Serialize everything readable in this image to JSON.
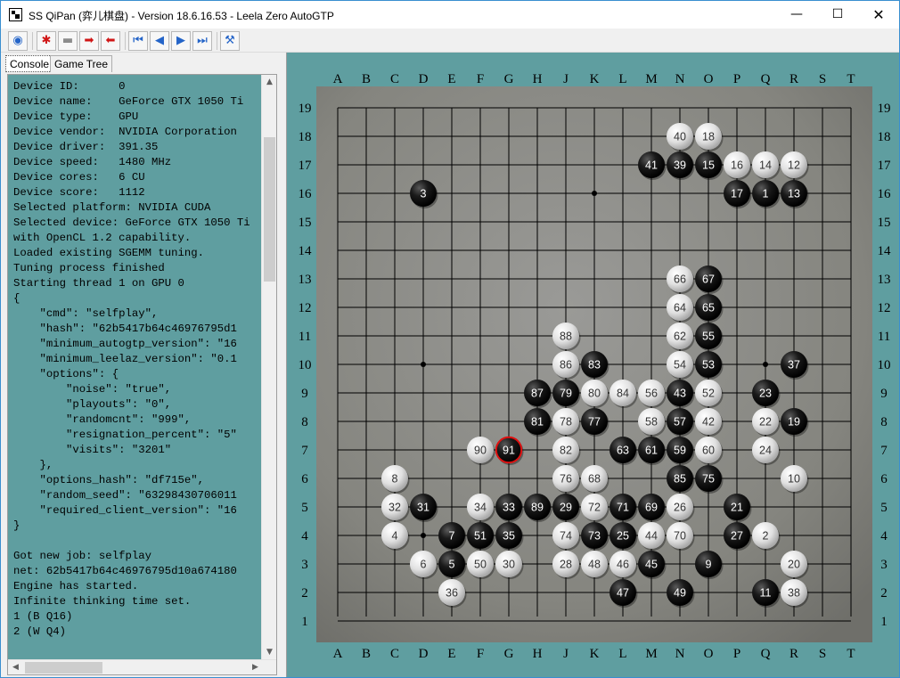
{
  "window": {
    "title": "SS QiPan (弈儿棋盘) - Version 18.6.16.53 - Leela Zero AutoGTP",
    "minimize_glyph": "—",
    "maximize_glyph": "☐",
    "close_glyph": "✕"
  },
  "toolbar": {
    "buttons": [
      {
        "name": "view-icon",
        "glyph": "◉",
        "style": "blue"
      },
      {
        "name": "mark-icon",
        "glyph": "✱",
        "style": "red"
      },
      {
        "name": "remove-icon",
        "glyph": "▬",
        "style": "gray"
      },
      {
        "name": "move-forward-icon",
        "glyph": "➡",
        "style": "red"
      },
      {
        "name": "move-back-icon",
        "glyph": "⬅",
        "style": "red"
      },
      {
        "name": "first-move-icon",
        "glyph": "⏮",
        "style": "blue"
      },
      {
        "name": "previous-move-icon",
        "glyph": "◀",
        "style": "blue"
      },
      {
        "name": "next-move-icon",
        "glyph": "▶",
        "style": "blue"
      },
      {
        "name": "last-move-icon",
        "glyph": "⏭",
        "style": "blue"
      },
      {
        "name": "settings-icon",
        "glyph": "⚒",
        "style": "blue"
      }
    ]
  },
  "tabs": {
    "console": "Console",
    "game_tree": "Game Tree"
  },
  "console": {
    "lines": [
      "Device ID:      0",
      "Device name:    GeForce GTX 1050 Ti",
      "Device type:    GPU",
      "Device vendor:  NVIDIA Corporation",
      "Device driver:  391.35",
      "Device speed:   1480 MHz",
      "Device cores:   6 CU",
      "Device score:   1112",
      "Selected platform: NVIDIA CUDA",
      "Selected device: GeForce GTX 1050 Ti",
      "with OpenCL 1.2 capability.",
      "Loaded existing SGEMM tuning.",
      "Tuning process finished",
      "Starting thread 1 on GPU 0",
      "{",
      "    \"cmd\": \"selfplay\",",
      "    \"hash\": \"62b5417b64c46976795d1",
      "    \"minimum_autogtp_version\": \"16",
      "    \"minimum_leelaz_version\": \"0.1",
      "    \"options\": {",
      "        \"noise\": \"true\",",
      "        \"playouts\": \"0\",",
      "        \"randomcnt\": \"999\",",
      "        \"resignation_percent\": \"5\"",
      "        \"visits\": \"3201\"",
      "    },",
      "    \"options_hash\": \"df715e\",",
      "    \"random_seed\": \"63298430706011",
      "    \"required_client_version\": \"16",
      "}",
      "",
      "Got new job: selfplay",
      "net: 62b5417b64c46976795d10a674180",
      "Engine has started.",
      "Infinite thinking time set.",
      "1 (B Q16)",
      "2 (W Q4)"
    ]
  },
  "board": {
    "size": 19,
    "columns": [
      "A",
      "B",
      "C",
      "D",
      "E",
      "F",
      "G",
      "H",
      "J",
      "K",
      "L",
      "M",
      "N",
      "O",
      "P",
      "Q",
      "R",
      "S",
      "T"
    ],
    "last_move": 91,
    "stones": [
      {
        "n": 1,
        "c": "B",
        "at": "Q16"
      },
      {
        "n": 2,
        "c": "W",
        "at": "Q4"
      },
      {
        "n": 3,
        "c": "B",
        "at": "D16"
      },
      {
        "n": 4,
        "c": "W",
        "at": "C4"
      },
      {
        "n": 5,
        "c": "B",
        "at": "E3"
      },
      {
        "n": 6,
        "c": "W",
        "at": "D3"
      },
      {
        "n": 7,
        "c": "B",
        "at": "E4"
      },
      {
        "n": 8,
        "c": "W",
        "at": "C6"
      },
      {
        "n": 9,
        "c": "B",
        "at": "O3"
      },
      {
        "n": 10,
        "c": "W",
        "at": "R6"
      },
      {
        "n": 11,
        "c": "B",
        "at": "Q2"
      },
      {
        "n": 12,
        "c": "W",
        "at": "R17"
      },
      {
        "n": 13,
        "c": "B",
        "at": "R16"
      },
      {
        "n": 14,
        "c": "W",
        "at": "Q17"
      },
      {
        "n": 15,
        "c": "B",
        "at": "O17"
      },
      {
        "n": 16,
        "c": "W",
        "at": "P17"
      },
      {
        "n": 17,
        "c": "B",
        "at": "P16"
      },
      {
        "n": 18,
        "c": "W",
        "at": "O18"
      },
      {
        "n": 19,
        "c": "B",
        "at": "R8"
      },
      {
        "n": 20,
        "c": "W",
        "at": "R3"
      },
      {
        "n": 21,
        "c": "B",
        "at": "P5"
      },
      {
        "n": 22,
        "c": "W",
        "at": "Q8"
      },
      {
        "n": 23,
        "c": "B",
        "at": "Q9"
      },
      {
        "n": 24,
        "c": "W",
        "at": "Q7"
      },
      {
        "n": 25,
        "c": "B",
        "at": "L4"
      },
      {
        "n": 26,
        "c": "W",
        "at": "N5"
      },
      {
        "n": 27,
        "c": "B",
        "at": "P4"
      },
      {
        "n": 28,
        "c": "W",
        "at": "J3"
      },
      {
        "n": 29,
        "c": "B",
        "at": "J5"
      },
      {
        "n": 30,
        "c": "W",
        "at": "G3"
      },
      {
        "n": 31,
        "c": "B",
        "at": "D5"
      },
      {
        "n": 32,
        "c": "W",
        "at": "C5"
      },
      {
        "n": 33,
        "c": "B",
        "at": "G5"
      },
      {
        "n": 34,
        "c": "W",
        "at": "F5"
      },
      {
        "n": 35,
        "c": "B",
        "at": "G4"
      },
      {
        "n": 36,
        "c": "W",
        "at": "E2"
      },
      {
        "n": 37,
        "c": "B",
        "at": "R10"
      },
      {
        "n": 38,
        "c": "W",
        "at": "R2"
      },
      {
        "n": 39,
        "c": "B",
        "at": "N17"
      },
      {
        "n": 40,
        "c": "W",
        "at": "N18"
      },
      {
        "n": 41,
        "c": "B",
        "at": "M17"
      },
      {
        "n": 42,
        "c": "W",
        "at": "O8"
      },
      {
        "n": 43,
        "c": "B",
        "at": "N9"
      },
      {
        "n": 44,
        "c": "W",
        "at": "M4"
      },
      {
        "n": 45,
        "c": "B",
        "at": "M3"
      },
      {
        "n": 46,
        "c": "W",
        "at": "L3"
      },
      {
        "n": 47,
        "c": "B",
        "at": "L2"
      },
      {
        "n": 48,
        "c": "W",
        "at": "K3"
      },
      {
        "n": 49,
        "c": "B",
        "at": "N2"
      },
      {
        "n": 50,
        "c": "W",
        "at": "F3"
      },
      {
        "n": 51,
        "c": "B",
        "at": "F4"
      },
      {
        "n": 52,
        "c": "W",
        "at": "O9"
      },
      {
        "n": 53,
        "c": "B",
        "at": "O10"
      },
      {
        "n": 54,
        "c": "W",
        "at": "N10"
      },
      {
        "n": 55,
        "c": "B",
        "at": "O11"
      },
      {
        "n": 56,
        "c": "W",
        "at": "M9"
      },
      {
        "n": 57,
        "c": "B",
        "at": "N8"
      },
      {
        "n": 58,
        "c": "W",
        "at": "M8"
      },
      {
        "n": 59,
        "c": "B",
        "at": "N7"
      },
      {
        "n": 60,
        "c": "W",
        "at": "O7"
      },
      {
        "n": 61,
        "c": "B",
        "at": "M7"
      },
      {
        "n": 62,
        "c": "W",
        "at": "N11"
      },
      {
        "n": 63,
        "c": "B",
        "at": "L7"
      },
      {
        "n": 64,
        "c": "W",
        "at": "N12"
      },
      {
        "n": 65,
        "c": "B",
        "at": "O12"
      },
      {
        "n": 66,
        "c": "W",
        "at": "N13"
      },
      {
        "n": 67,
        "c": "B",
        "at": "O13"
      },
      {
        "n": 68,
        "c": "W",
        "at": "K6"
      },
      {
        "n": 69,
        "c": "B",
        "at": "M5"
      },
      {
        "n": 70,
        "c": "W",
        "at": "N4"
      },
      {
        "n": 71,
        "c": "B",
        "at": "L5"
      },
      {
        "n": 72,
        "c": "W",
        "at": "K5"
      },
      {
        "n": 73,
        "c": "B",
        "at": "K4"
      },
      {
        "n": 74,
        "c": "W",
        "at": "J4"
      },
      {
        "n": 75,
        "c": "B",
        "at": "O6"
      },
      {
        "n": 76,
        "c": "W",
        "at": "J6"
      },
      {
        "n": 77,
        "c": "B",
        "at": "K8"
      },
      {
        "n": 78,
        "c": "W",
        "at": "J8"
      },
      {
        "n": 79,
        "c": "B",
        "at": "J9"
      },
      {
        "n": 80,
        "c": "W",
        "at": "K9"
      },
      {
        "n": 81,
        "c": "B",
        "at": "H8"
      },
      {
        "n": 82,
        "c": "W",
        "at": "J7"
      },
      {
        "n": 83,
        "c": "B",
        "at": "K10"
      },
      {
        "n": 84,
        "c": "W",
        "at": "L9"
      },
      {
        "n": 85,
        "c": "B",
        "at": "N6"
      },
      {
        "n": 86,
        "c": "W",
        "at": "J10"
      },
      {
        "n": 87,
        "c": "B",
        "at": "H9"
      },
      {
        "n": 88,
        "c": "W",
        "at": "J11"
      },
      {
        "n": 89,
        "c": "B",
        "at": "H5"
      },
      {
        "n": 90,
        "c": "W",
        "at": "F7"
      },
      {
        "n": 91,
        "c": "B",
        "at": "G7"
      }
    ]
  },
  "colors": {
    "panel_bg": "#5f9ea0",
    "board_wood": "#8a8a88",
    "black_stone": "#111111",
    "white_stone": "#e6e6e6",
    "last_move_ring": "#e01010"
  }
}
